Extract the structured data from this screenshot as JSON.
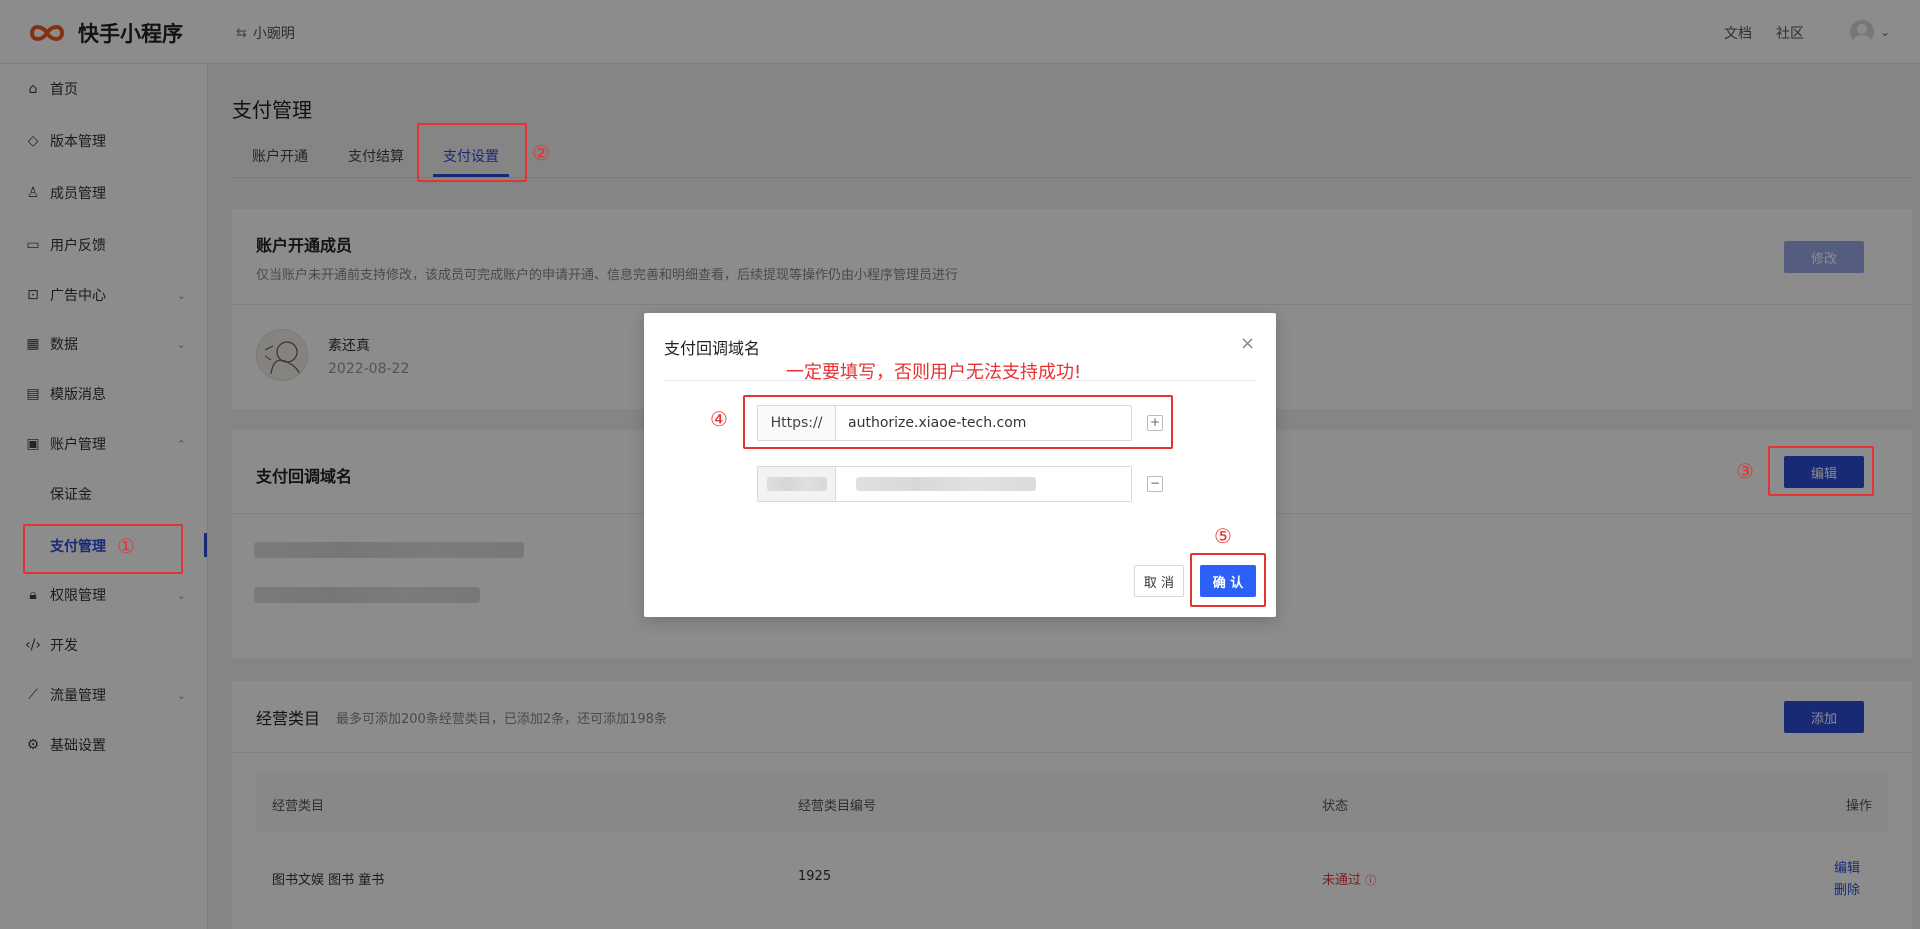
{
  "header": {
    "app_name": "快手小程序",
    "switch_label": "小豌明",
    "links": [
      "文档",
      "社区"
    ]
  },
  "sidebar": {
    "items": [
      {
        "label": "首页",
        "icon": "home-icon"
      },
      {
        "label": "版本管理",
        "icon": "layers-icon"
      },
      {
        "label": "成员管理",
        "icon": "user-icon"
      },
      {
        "label": "用户反馈",
        "icon": "message-icon"
      },
      {
        "label": "广告中心",
        "icon": "ad-icon"
      },
      {
        "label": "数据",
        "icon": "chart-icon"
      },
      {
        "label": "模版消息",
        "icon": "template-icon"
      },
      {
        "label": "账户管理",
        "icon": "account-icon"
      },
      {
        "label": "保证金",
        "icon": ""
      },
      {
        "label": "支付管理",
        "icon": ""
      },
      {
        "label": "权限管理",
        "icon": "lock-icon"
      },
      {
        "label": "开发",
        "icon": "code-icon"
      },
      {
        "label": "流量管理",
        "icon": "trend-icon"
      },
      {
        "label": "基础设置",
        "icon": "gear-icon"
      }
    ]
  },
  "main": {
    "title": "支付管理",
    "tabs": [
      {
        "label": "账户开通"
      },
      {
        "label": "支付结算"
      },
      {
        "label": "支付设置"
      }
    ]
  },
  "member_card": {
    "title": "账户开通成员",
    "desc": "仅当账户未开通前支持修改，该成员可完成账户的申请开通、信息完善和明细查看，后续提现等操作仍由小程序管理员进行",
    "edit_label": "修改",
    "member_name": "素还真",
    "member_date": "2022-08-22"
  },
  "callback_card": {
    "title": "支付回调域名",
    "edit_label": "编辑"
  },
  "category_card": {
    "title": "经营类目",
    "desc": "最多可添加200条经营类目，已添加2条，还可添加198条",
    "add_label": "添加",
    "columns": [
      "经营类目",
      "经营类目编号",
      "状态",
      "操作"
    ],
    "rows": [
      {
        "category": "图书文娱 图书 童书",
        "code": "1925",
        "status": "未通过",
        "op_edit": "编辑",
        "op_delete": "删除"
      }
    ]
  },
  "modal": {
    "title": "支付回调域名",
    "protocol": "Https://",
    "domain_value": "authorize.xiaoe-tech.com",
    "add_symbol": "+",
    "remove_symbol": "−",
    "cancel_label": "取 消",
    "ok_label": "确 认"
  },
  "annotations": {
    "note": "一定要填写，否则用户无法支持成功!",
    "marks": [
      "①",
      "②",
      "③",
      "④",
      "⑤"
    ],
    "color": "#e53333"
  },
  "colors": {
    "primary": "#2c4bd7",
    "confirm": "#2c61f7",
    "error": "#e03a3a"
  }
}
